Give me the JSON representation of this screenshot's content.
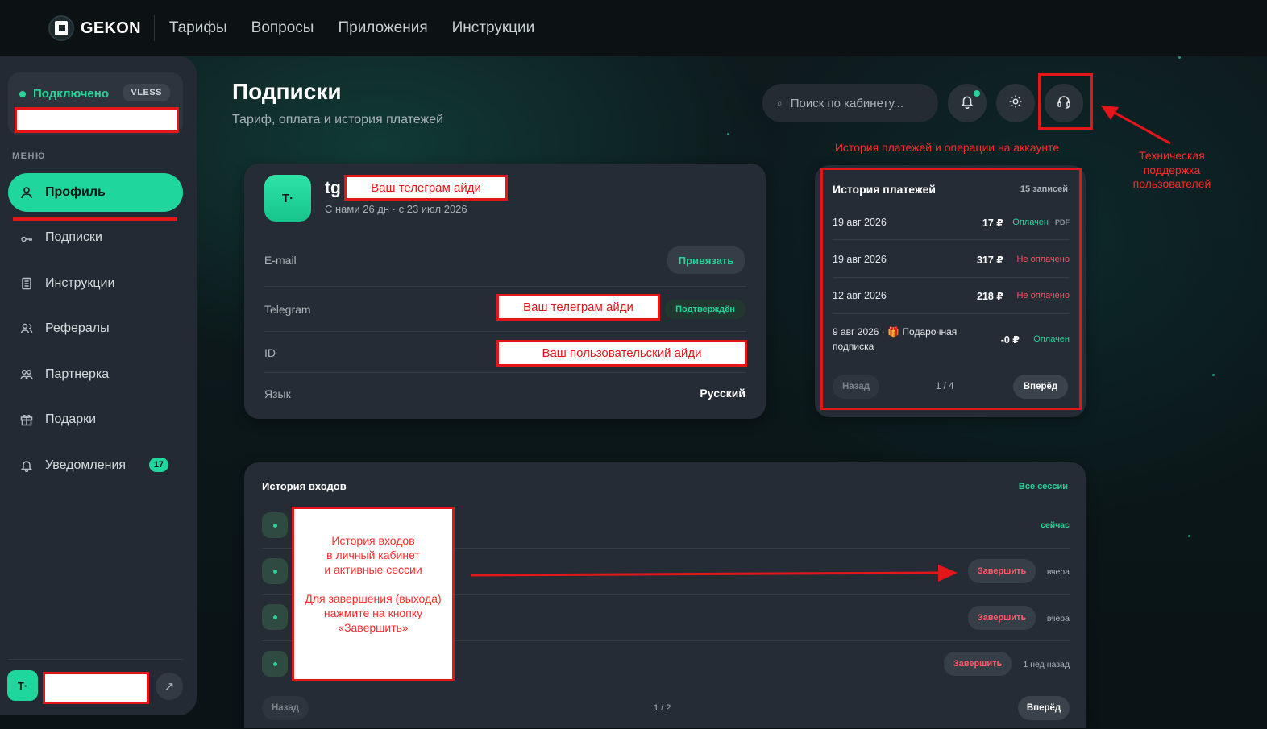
{
  "brand": {
    "name": "GEKON"
  },
  "topnav": {
    "items": [
      "Тарифы",
      "Вопросы",
      "Приложения",
      "Инструкции"
    ]
  },
  "sidebar": {
    "status": "Подключено",
    "protocol": "VLESS",
    "menu_label": "МЕНЮ",
    "items": [
      {
        "label": "Профиль",
        "icon": "user-icon"
      },
      {
        "label": "Подписки",
        "icon": "key-icon"
      },
      {
        "label": "Инструкции",
        "icon": "document-icon"
      },
      {
        "label": "Рефералы",
        "icon": "users-icon"
      },
      {
        "label": "Партнерка",
        "icon": "partners-icon"
      },
      {
        "label": "Подарки",
        "icon": "gift-icon"
      },
      {
        "label": "Уведомления",
        "icon": "bell-icon",
        "badge": "17"
      }
    ],
    "user_initials": "T·"
  },
  "header": {
    "title": "Подписки",
    "subtitle": "Тариф, оплата и история платежей",
    "search_placeholder": "Поиск по кабинету..."
  },
  "profile": {
    "initials": "T·",
    "tg_prefix": "tg",
    "tg_redaction": "Ваш телеграм айди",
    "since": "С нами 26 дн · с 23 июл 2026",
    "email_label": "E-mail",
    "email_action": "Привязать",
    "telegram_label": "Telegram",
    "telegram_redaction": "Ваш телеграм айди",
    "telegram_status": "Подтверждён",
    "id_label": "ID",
    "id_redaction": "Ваш пользовательский айди",
    "lang_label": "Язык",
    "lang_value": "Русский"
  },
  "payments": {
    "title": "История платежей",
    "count": "15 записей",
    "rows": [
      {
        "date": "19 авг 2026",
        "amount": "17 ₽",
        "status": "Оплачен",
        "pdf": "PDF"
      },
      {
        "date": "19 авг 2026",
        "amount": "317 ₽",
        "status": "Не оплачено"
      },
      {
        "date": "12 авг 2026",
        "amount": "218 ₽",
        "status": "Не оплачено"
      },
      {
        "date_line1": "9 авг 2026 · 🎁 Подарочная",
        "date_line2": "подписка",
        "amount": "-0 ₽",
        "status": "Оплачен"
      }
    ],
    "prev": "Назад",
    "page": "1 / 4",
    "next": "Вперёд"
  },
  "sessions": {
    "title": "История входов",
    "all_link": "Все сессии",
    "rows": [
      {
        "time": "сейчас"
      },
      {
        "action": "Завершить",
        "time": "вчера"
      },
      {
        "action": "Завершить",
        "time": "вчера"
      },
      {
        "action": "Завершить",
        "time": "1 нед назад"
      }
    ],
    "prev": "Назад",
    "page": "1 / 2",
    "next": "Вперёд"
  },
  "annotations": {
    "payments_caption": "История платежей и операции на аккаунте",
    "support_caption": "Техническая\nподдержка\nпользователей",
    "sessions_note_1": "История входов\nв личный кабинет\nи активные сессии",
    "sessions_note_2": "Для завершения (выхода)\nнажмите на кнопку\n«Завершить»"
  },
  "colors": {
    "accent": "#1fd69c",
    "danger": "#ff4d5e",
    "annotation": "#e5161a"
  }
}
